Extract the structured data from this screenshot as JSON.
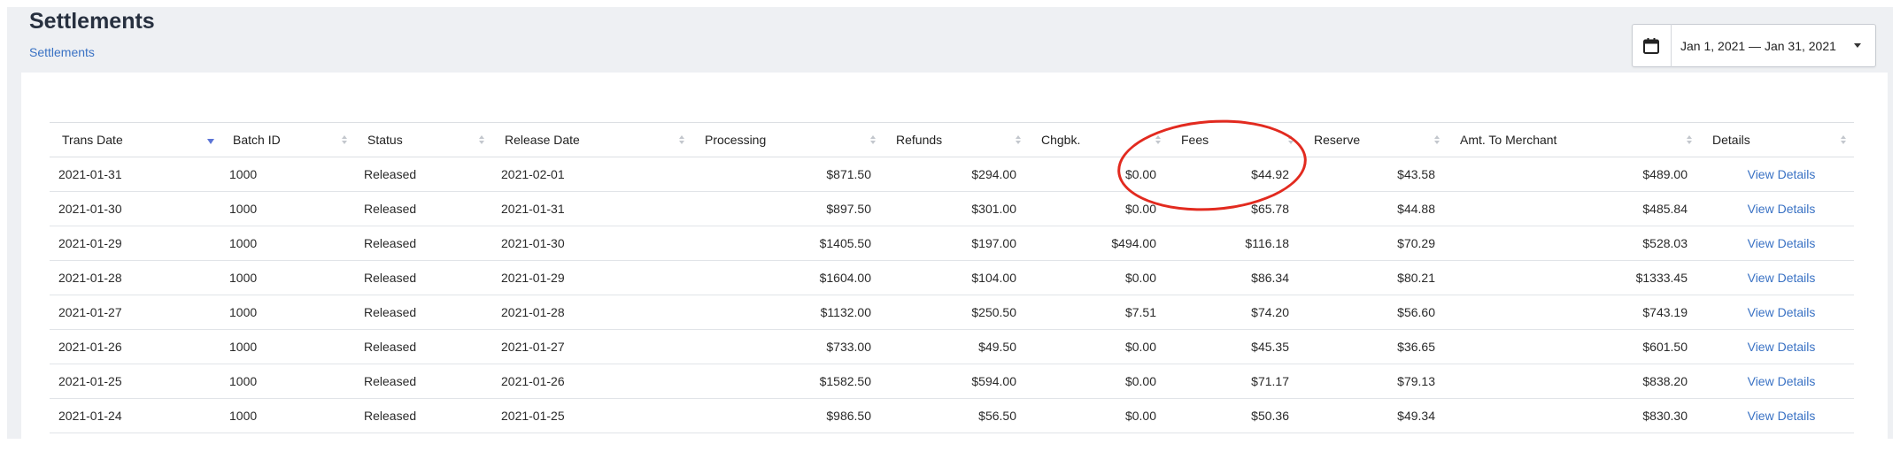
{
  "header": {
    "title": "Settlements",
    "breadcrumb": "Settlements"
  },
  "date_range": {
    "label": "Jan 1, 2021 — Jan 31, 2021",
    "icon": "calendar-icon"
  },
  "table": {
    "columns": [
      "Trans Date",
      "Batch ID",
      "Status",
      "Release Date",
      "Processing",
      "Refunds",
      "Chgbk.",
      "Fees",
      "Reserve",
      "Amt. To Merchant",
      "Details"
    ],
    "rows": [
      {
        "trans_date": "2021-01-31",
        "batch_id": "1000",
        "status": "Released",
        "release_date": "2021-02-01",
        "processing": "$871.50",
        "refunds": "$294.00",
        "chgbk": "$0.00",
        "fees": "$44.92",
        "reserve": "$43.58",
        "amt_to_merchant": "$489.00",
        "details": "View Details"
      },
      {
        "trans_date": "2021-01-30",
        "batch_id": "1000",
        "status": "Released",
        "release_date": "2021-01-31",
        "processing": "$897.50",
        "refunds": "$301.00",
        "chgbk": "$0.00",
        "fees": "$65.78",
        "reserve": "$44.88",
        "amt_to_merchant": "$485.84",
        "details": "View Details"
      },
      {
        "trans_date": "2021-01-29",
        "batch_id": "1000",
        "status": "Released",
        "release_date": "2021-01-30",
        "processing": "$1405.50",
        "refunds": "$197.00",
        "chgbk": "$494.00",
        "fees": "$116.18",
        "reserve": "$70.29",
        "amt_to_merchant": "$528.03",
        "details": "View Details"
      },
      {
        "trans_date": "2021-01-28",
        "batch_id": "1000",
        "status": "Released",
        "release_date": "2021-01-29",
        "processing": "$1604.00",
        "refunds": "$104.00",
        "chgbk": "$0.00",
        "fees": "$86.34",
        "reserve": "$80.21",
        "amt_to_merchant": "$1333.45",
        "details": "View Details"
      },
      {
        "trans_date": "2021-01-27",
        "batch_id": "1000",
        "status": "Released",
        "release_date": "2021-01-28",
        "processing": "$1132.00",
        "refunds": "$250.50",
        "chgbk": "$7.51",
        "fees": "$74.20",
        "reserve": "$56.60",
        "amt_to_merchant": "$743.19",
        "details": "View Details"
      },
      {
        "trans_date": "2021-01-26",
        "batch_id": "1000",
        "status": "Released",
        "release_date": "2021-01-27",
        "processing": "$733.00",
        "refunds": "$49.50",
        "chgbk": "$0.00",
        "fees": "$45.35",
        "reserve": "$36.65",
        "amt_to_merchant": "$601.50",
        "details": "View Details"
      },
      {
        "trans_date": "2021-01-25",
        "batch_id": "1000",
        "status": "Released",
        "release_date": "2021-01-26",
        "processing": "$1582.50",
        "refunds": "$594.00",
        "chgbk": "$0.00",
        "fees": "$71.17",
        "reserve": "$79.13",
        "amt_to_merchant": "$838.20",
        "details": "View Details"
      },
      {
        "trans_date": "2021-01-24",
        "batch_id": "1000",
        "status": "Released",
        "release_date": "2021-01-25",
        "processing": "$986.50",
        "refunds": "$56.50",
        "chgbk": "$0.00",
        "fees": "$50.36",
        "reserve": "$49.34",
        "amt_to_merchant": "$830.30",
        "details": "View Details"
      }
    ]
  },
  "colors": {
    "status_released": "#6cc24a",
    "link": "#3a72c4",
    "annotation": "#e22a1f"
  }
}
